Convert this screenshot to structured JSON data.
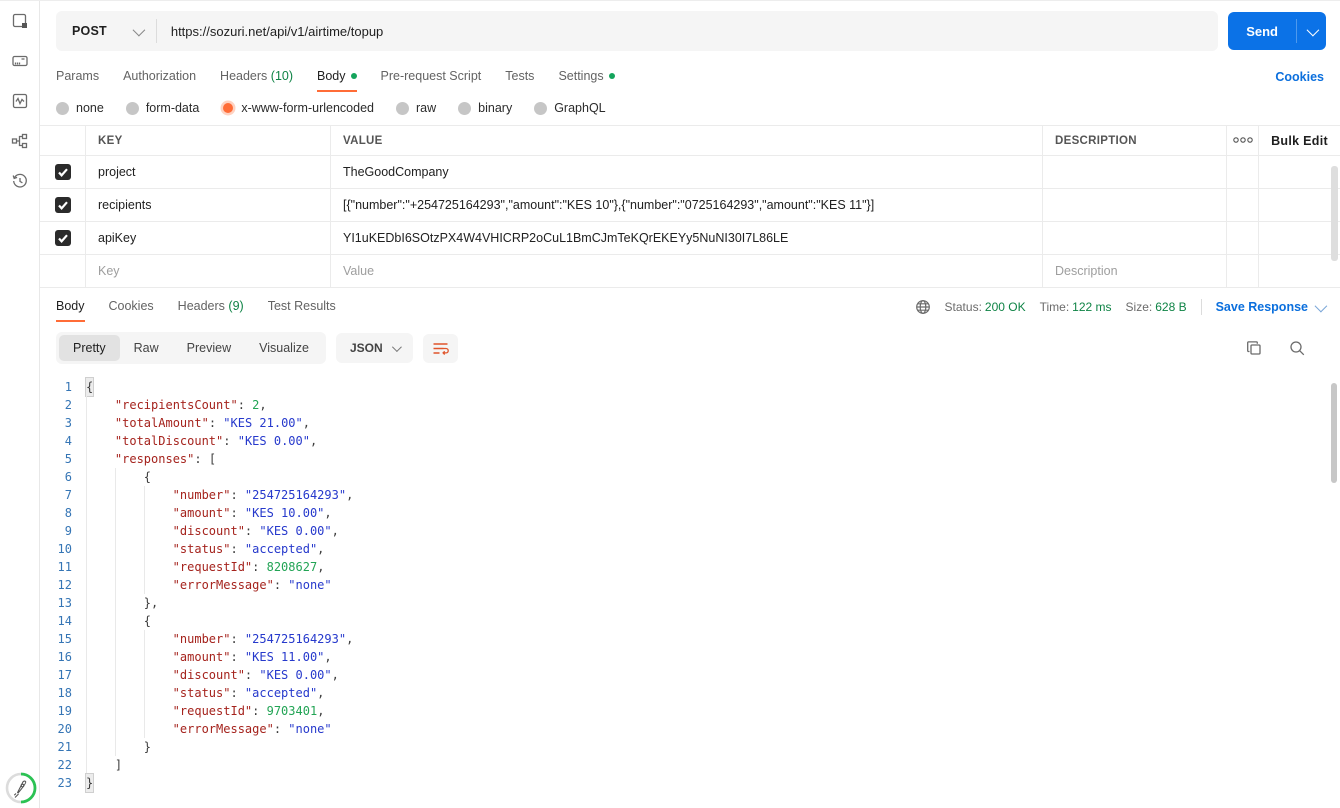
{
  "colors": {
    "accent_orange": "#ff6c37",
    "primary_blue": "#0b72e7",
    "success_green": "#0e8345",
    "code_key": "#a5231d",
    "code_string": "#2639cc",
    "code_number": "#22a455"
  },
  "sidebar": {
    "icons": [
      "collections-icon",
      "environments-icon",
      "monitor-icon",
      "flows-icon",
      "history-icon",
      "bootcamp-rocket-icon"
    ]
  },
  "request": {
    "method": "POST",
    "url": "https://sozuri.net/api/v1/airtime/topup",
    "send_label": "Send",
    "cookies_link": "Cookies",
    "tabs": [
      {
        "label": "Params",
        "count": "",
        "dot": false,
        "active": false
      },
      {
        "label": "Authorization",
        "count": "",
        "dot": false,
        "active": false
      },
      {
        "label": "Headers",
        "count": "(10)",
        "dot": false,
        "active": false
      },
      {
        "label": "Body",
        "count": "",
        "dot": true,
        "active": true
      },
      {
        "label": "Pre-request Script",
        "count": "",
        "dot": false,
        "active": false
      },
      {
        "label": "Tests",
        "count": "",
        "dot": false,
        "active": false
      },
      {
        "label": "Settings",
        "count": "",
        "dot": true,
        "active": false
      }
    ],
    "body_modes": [
      {
        "label": "none",
        "selected": false
      },
      {
        "label": "form-data",
        "selected": false
      },
      {
        "label": "x-www-form-urlencoded",
        "selected": true
      },
      {
        "label": "raw",
        "selected": false
      },
      {
        "label": "binary",
        "selected": false
      },
      {
        "label": "GraphQL",
        "selected": false
      }
    ],
    "table": {
      "headers": {
        "key": "KEY",
        "value": "VALUE",
        "description": "DESCRIPTION"
      },
      "bulk_edit_label": "Bulk Edit",
      "rows": [
        {
          "checked": true,
          "key": "project",
          "value": "TheGoodCompany",
          "description": ""
        },
        {
          "checked": true,
          "key": "recipients",
          "value": "[{\"number\":\"+254725164293\",\"amount\":\"KES 10\"},{\"number\":\"0725164293\",\"amount\":\"KES 11\"}]",
          "description": ""
        },
        {
          "checked": true,
          "key": "apiKey",
          "value": "YI1uKEDbI6SOtzPX4W4VHICRP2oCuL1BmCJmTeKQrEKEYy5NuNI30I7L86LE",
          "description": ""
        }
      ],
      "placeholder_row": {
        "key": "Key",
        "value": "Value",
        "description": "Description"
      }
    }
  },
  "response": {
    "tabs": [
      {
        "label": "Body",
        "count": "",
        "active": true
      },
      {
        "label": "Cookies",
        "count": "",
        "active": false
      },
      {
        "label": "Headers",
        "count": "(9)",
        "active": false
      },
      {
        "label": "Test Results",
        "count": "",
        "active": false
      }
    ],
    "meta": {
      "status_label": "Status:",
      "status_value": "200 OK",
      "time_label": "Time:",
      "time_value": "122 ms",
      "size_label": "Size:",
      "size_value": "628 B"
    },
    "save_response_label": "Save Response",
    "view_tabs": [
      {
        "label": "Pretty",
        "selected": true
      },
      {
        "label": "Raw",
        "selected": false
      },
      {
        "label": "Preview",
        "selected": false
      },
      {
        "label": "Visualize",
        "selected": false
      }
    ],
    "format_label": "JSON",
    "body_json": {
      "recipientsCount": 2,
      "totalAmount": "KES 21.00",
      "totalDiscount": "KES 0.00",
      "responses": [
        {
          "number": "254725164293",
          "amount": "KES 10.00",
          "discount": "KES 0.00",
          "status": "accepted",
          "requestId": 8208627,
          "errorMessage": "none"
        },
        {
          "number": "254725164293",
          "amount": "KES 11.00",
          "discount": "KES 0.00",
          "status": "accepted",
          "requestId": 9703401,
          "errorMessage": "none"
        }
      ]
    },
    "code_lines": [
      {
        "n": 1,
        "g": 0,
        "hl": true,
        "t": [
          [
            "p",
            "{"
          ]
        ]
      },
      {
        "n": 2,
        "g": 1,
        "t": [
          [
            "k",
            "\"recipientsCount\""
          ],
          [
            "p",
            ": "
          ],
          [
            "n",
            "2"
          ],
          [
            "p",
            ","
          ]
        ]
      },
      {
        "n": 3,
        "g": 1,
        "t": [
          [
            "k",
            "\"totalAmount\""
          ],
          [
            "p",
            ": "
          ],
          [
            "s",
            "\"KES 21.00\""
          ],
          [
            "p",
            ","
          ]
        ]
      },
      {
        "n": 4,
        "g": 1,
        "t": [
          [
            "k",
            "\"totalDiscount\""
          ],
          [
            "p",
            ": "
          ],
          [
            "s",
            "\"KES 0.00\""
          ],
          [
            "p",
            ","
          ]
        ]
      },
      {
        "n": 5,
        "g": 1,
        "t": [
          [
            "k",
            "\"responses\""
          ],
          [
            "p",
            ": ["
          ]
        ]
      },
      {
        "n": 6,
        "g": 2,
        "t": [
          [
            "p",
            "{"
          ]
        ]
      },
      {
        "n": 7,
        "g": 3,
        "t": [
          [
            "k",
            "\"number\""
          ],
          [
            "p",
            ": "
          ],
          [
            "s",
            "\"254725164293\""
          ],
          [
            "p",
            ","
          ]
        ]
      },
      {
        "n": 8,
        "g": 3,
        "t": [
          [
            "k",
            "\"amount\""
          ],
          [
            "p",
            ": "
          ],
          [
            "s",
            "\"KES 10.00\""
          ],
          [
            "p",
            ","
          ]
        ]
      },
      {
        "n": 9,
        "g": 3,
        "t": [
          [
            "k",
            "\"discount\""
          ],
          [
            "p",
            ": "
          ],
          [
            "s",
            "\"KES 0.00\""
          ],
          [
            "p",
            ","
          ]
        ]
      },
      {
        "n": 10,
        "g": 3,
        "t": [
          [
            "k",
            "\"status\""
          ],
          [
            "p",
            ": "
          ],
          [
            "s",
            "\"accepted\""
          ],
          [
            "p",
            ","
          ]
        ]
      },
      {
        "n": 11,
        "g": 3,
        "t": [
          [
            "k",
            "\"requestId\""
          ],
          [
            "p",
            ": "
          ],
          [
            "n",
            "8208627"
          ],
          [
            "p",
            ","
          ]
        ]
      },
      {
        "n": 12,
        "g": 3,
        "t": [
          [
            "k",
            "\"errorMessage\""
          ],
          [
            "p",
            ": "
          ],
          [
            "s",
            "\"none\""
          ]
        ]
      },
      {
        "n": 13,
        "g": 2,
        "t": [
          [
            "p",
            "},"
          ]
        ]
      },
      {
        "n": 14,
        "g": 2,
        "t": [
          [
            "p",
            "{"
          ]
        ]
      },
      {
        "n": 15,
        "g": 3,
        "t": [
          [
            "k",
            "\"number\""
          ],
          [
            "p",
            ": "
          ],
          [
            "s",
            "\"254725164293\""
          ],
          [
            "p",
            ","
          ]
        ]
      },
      {
        "n": 16,
        "g": 3,
        "t": [
          [
            "k",
            "\"amount\""
          ],
          [
            "p",
            ": "
          ],
          [
            "s",
            "\"KES 11.00\""
          ],
          [
            "p",
            ","
          ]
        ]
      },
      {
        "n": 17,
        "g": 3,
        "t": [
          [
            "k",
            "\"discount\""
          ],
          [
            "p",
            ": "
          ],
          [
            "s",
            "\"KES 0.00\""
          ],
          [
            "p",
            ","
          ]
        ]
      },
      {
        "n": 18,
        "g": 3,
        "t": [
          [
            "k",
            "\"status\""
          ],
          [
            "p",
            ": "
          ],
          [
            "s",
            "\"accepted\""
          ],
          [
            "p",
            ","
          ]
        ]
      },
      {
        "n": 19,
        "g": 3,
        "t": [
          [
            "k",
            "\"requestId\""
          ],
          [
            "p",
            ": "
          ],
          [
            "n",
            "9703401"
          ],
          [
            "p",
            ","
          ]
        ]
      },
      {
        "n": 20,
        "g": 3,
        "t": [
          [
            "k",
            "\"errorMessage\""
          ],
          [
            "p",
            ": "
          ],
          [
            "s",
            "\"none\""
          ]
        ]
      },
      {
        "n": 21,
        "g": 2,
        "t": [
          [
            "p",
            "}"
          ]
        ]
      },
      {
        "n": 22,
        "g": 1,
        "t": [
          [
            "p",
            "]"
          ]
        ]
      },
      {
        "n": 23,
        "g": 0,
        "hl": true,
        "t": [
          [
            "p",
            "}"
          ]
        ]
      }
    ]
  }
}
